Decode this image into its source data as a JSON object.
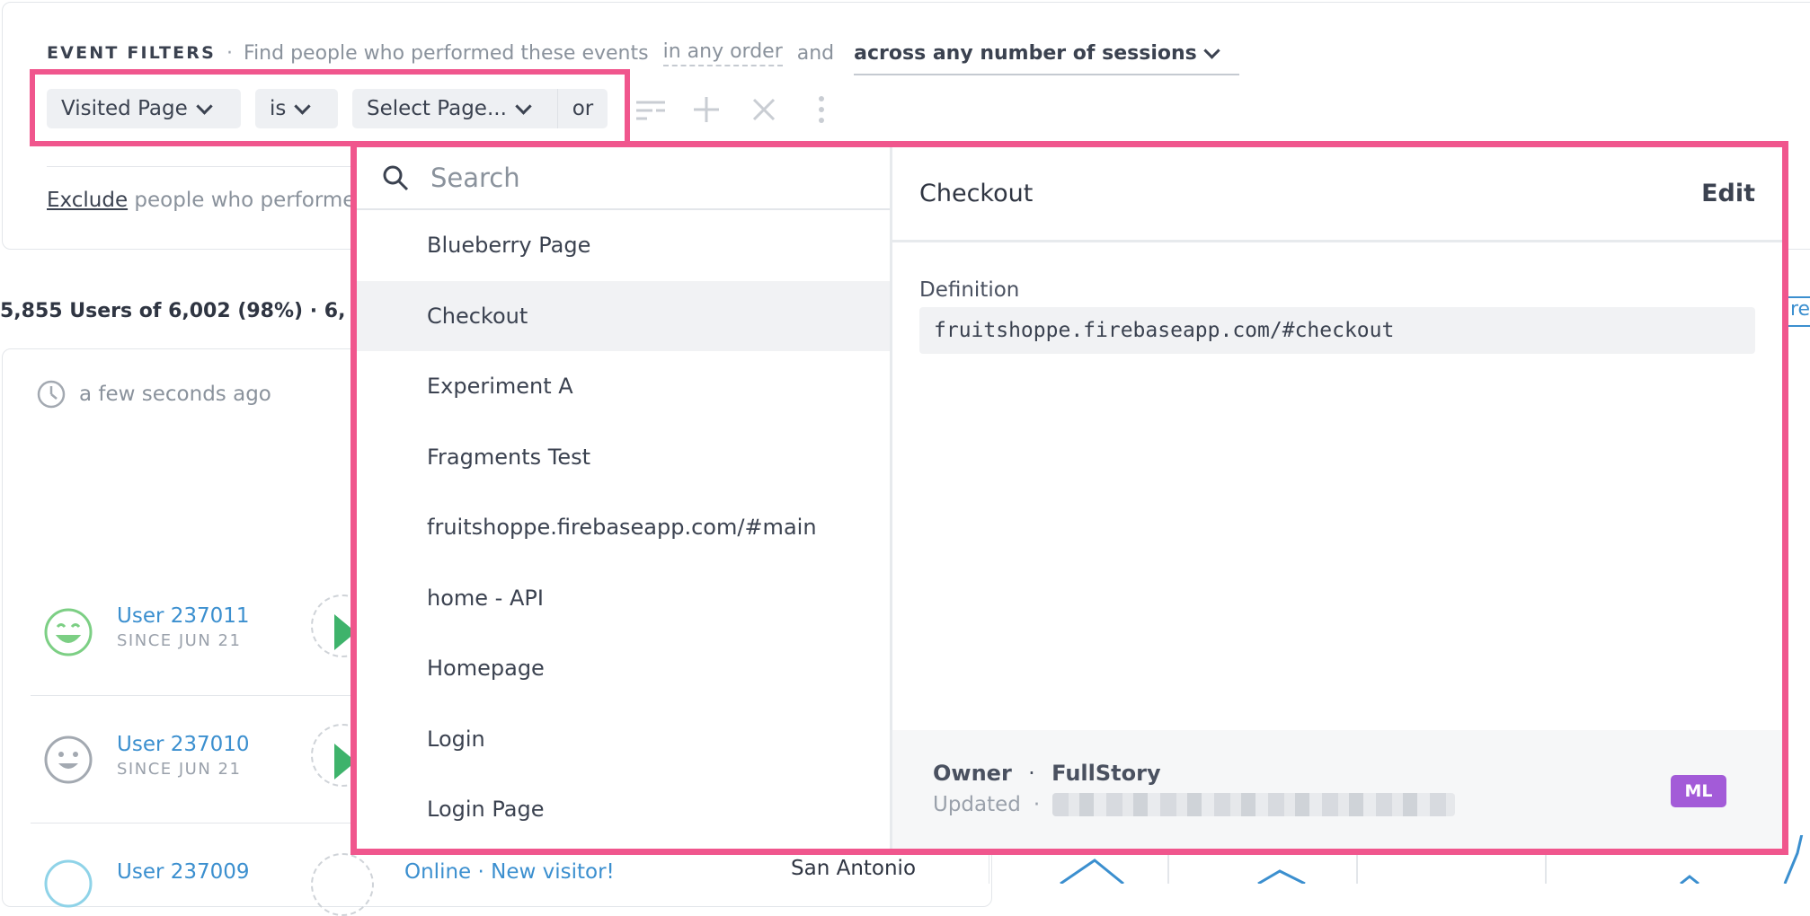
{
  "event_filters": {
    "title": "EVENT FILTERS",
    "dot": "·",
    "subtitle": "Find people who performed these events",
    "order_option": "in any order",
    "and_text": "and",
    "session_option": "across any number of sessions"
  },
  "filter_row": {
    "event": "Visited Page",
    "operator": "is",
    "value_placeholder": "Select Page...",
    "or_label": "or"
  },
  "exclude": {
    "link": "Exclude",
    "text": "people who performe"
  },
  "summary": {
    "text": "5,855 Users of 6,002 (98%)  ·  6,"
  },
  "last_activity": "a few seconds ago",
  "users": [
    {
      "name": "User 237011",
      "since": "SINCE JUN 21"
    },
    {
      "name": "User 237010",
      "since": "SINCE JUN 21"
    },
    {
      "name": "User 237009"
    }
  ],
  "partial_row": {
    "status": "Online · New visitor!",
    "location": "San Antonio"
  },
  "partial_right_link": "rea",
  "dropdown": {
    "search_placeholder": "Search",
    "options": [
      "Blueberry Page",
      "Checkout",
      "Experiment A",
      "Fragments Test",
      "fruitshoppe.firebaseapp.com/#main",
      "home - API",
      "Homepage",
      "Login",
      "Login Page"
    ],
    "selected_index": 1,
    "detail": {
      "title": "Checkout",
      "edit_label": "Edit",
      "definition_label": "Definition",
      "definition_value": "fruitshoppe.firebaseapp.com/#checkout",
      "owner_label": "Owner",
      "owner_sep": "·",
      "owner_value": "FullStory",
      "updated_label": "Updated",
      "updated_sep": "·",
      "badge": "ML"
    }
  },
  "colors": {
    "highlight": "#f0568d",
    "link": "#3b8fcf",
    "badge": "#a35bd8"
  }
}
